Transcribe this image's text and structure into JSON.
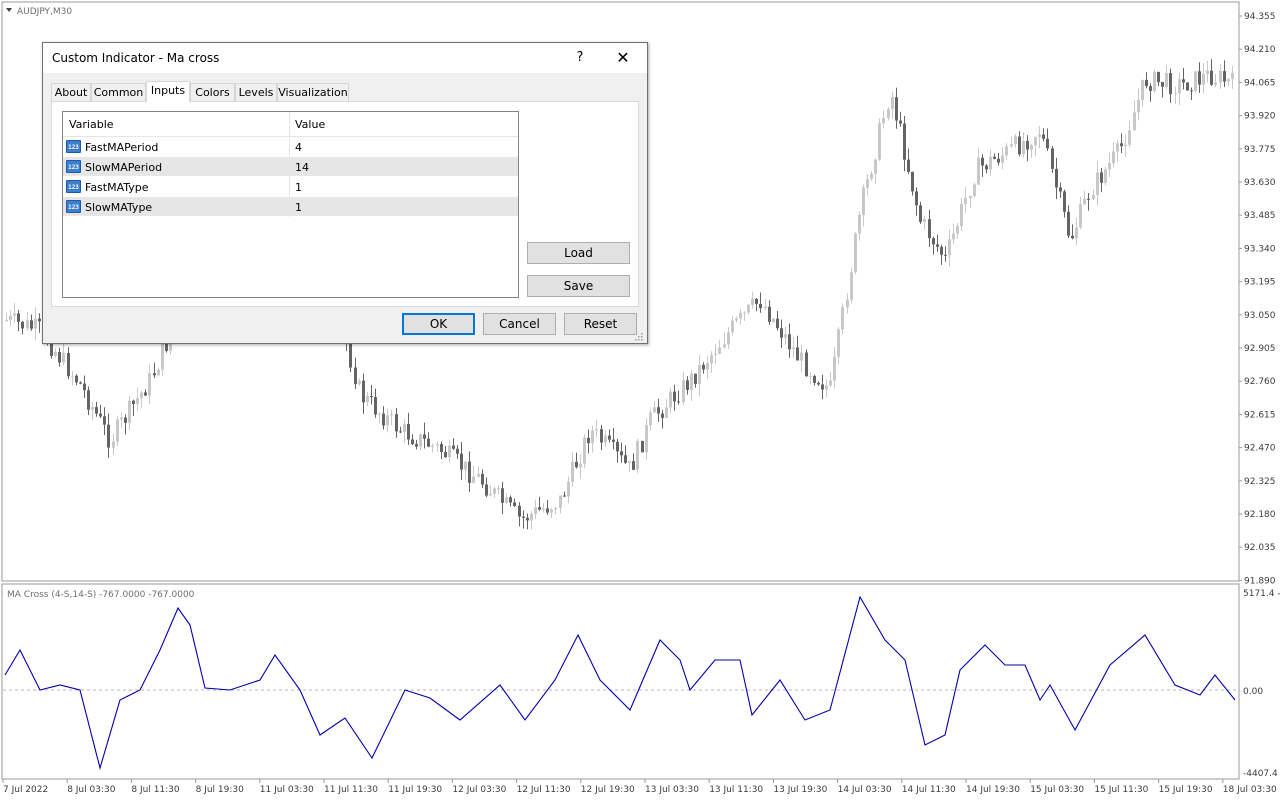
{
  "chart": {
    "symbol_label": "AUDJPY,M30",
    "price_ticks": [
      "94.355",
      "94.210",
      "94.065",
      "93.920",
      "93.775",
      "93.630",
      "93.485",
      "93.340",
      "93.195",
      "93.050",
      "92.905",
      "92.760",
      "92.615",
      "92.470",
      "92.325",
      "92.180",
      "92.035",
      "91.890"
    ],
    "time_ticks": [
      "7 Jul 2022",
      "8 Jul 03:30",
      "8 Jul 11:30",
      "8 Jul 19:30",
      "11 Jul 03:30",
      "11 Jul 11:30",
      "11 Jul 19:30",
      "12 Jul 03:30",
      "12 Jul 11:30",
      "12 Jul 19:30",
      "13 Jul 03:30",
      "13 Jul 11:30",
      "13 Jul 19:30",
      "14 Jul 03:30",
      "14 Jul 11:30",
      "14 Jul 19:30",
      "15 Jul 03:30",
      "15 Jul 11:30",
      "15 Jul 19:30",
      "18 Jul 03:30"
    ],
    "colors": {
      "bull": "#c8c8c8",
      "bear": "#646464",
      "indicator_line": "#0000aa"
    }
  },
  "indicator": {
    "label": "MA Cross (4-S,14-S)  -767.0000  -767.0000",
    "scale_ticks": [
      "5171.4 -",
      "0.00",
      "-4407.4"
    ]
  },
  "dialog": {
    "title": "Custom Indicator - Ma cross",
    "help_label": "?",
    "close_label": "✕",
    "tabs": [
      {
        "label": "About"
      },
      {
        "label": "Common"
      },
      {
        "label": "Inputs"
      },
      {
        "label": "Colors"
      },
      {
        "label": "Levels"
      },
      {
        "label": "Visualization"
      }
    ],
    "active_tab": "Inputs",
    "grid": {
      "headers": {
        "variable": "Variable",
        "value": "Value"
      },
      "rows": [
        {
          "icon": "123",
          "variable": "FastMAPeriod",
          "value": "4"
        },
        {
          "icon": "123",
          "variable": "SlowMAPeriod",
          "value": "14"
        },
        {
          "icon": "123",
          "variable": "FastMAType",
          "value": "1"
        },
        {
          "icon": "123",
          "variable": "SlowMAType",
          "value": "1"
        }
      ]
    },
    "buttons": {
      "load": "Load",
      "save": "Save",
      "ok": "OK",
      "cancel": "Cancel",
      "reset": "Reset"
    }
  }
}
